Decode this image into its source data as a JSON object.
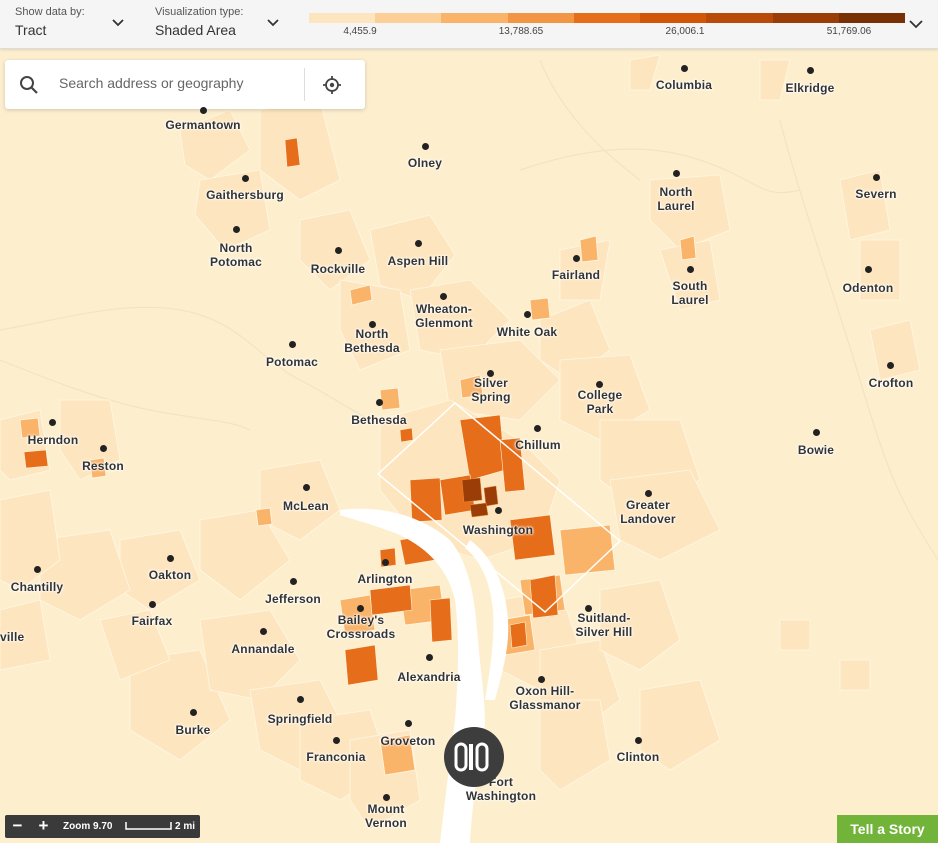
{
  "controls": {
    "show_data": {
      "label": "Show data by:",
      "value": "Tract"
    },
    "viz_type": {
      "label": "Visualization type:",
      "value": "Shaded Area"
    }
  },
  "legend": {
    "colors": [
      "#fde6bf",
      "#fbcf95",
      "#f9b46a",
      "#f29545",
      "#e66e1b",
      "#d25608",
      "#b84b07",
      "#9a3d06",
      "#7a3005"
    ],
    "ticks": [
      "4,455.9",
      "13,788.65",
      "26,006.1",
      "51,769.06"
    ]
  },
  "search": {
    "placeholder": "Search address or geography"
  },
  "map": {
    "water_color": "#ffffff",
    "base_color": "#fdefce",
    "places": [
      {
        "name": "Columbia"
      },
      {
        "name": "Elkridge"
      },
      {
        "name": "Germantown"
      },
      {
        "name": "Olney"
      },
      {
        "name": "Gaithersburg"
      },
      {
        "name": "North\nLaurel"
      },
      {
        "name": "Severn"
      },
      {
        "name": "North\nPotomac"
      },
      {
        "name": "Rockville"
      },
      {
        "name": "Aspen Hill"
      },
      {
        "name": "Fairland"
      },
      {
        "name": "South\nLaurel"
      },
      {
        "name": "Odenton"
      },
      {
        "name": "Wheaton-\nGlenmont"
      },
      {
        "name": "White Oak"
      },
      {
        "name": "North\nBethesda"
      },
      {
        "name": "Potomac"
      },
      {
        "name": "Silver\nSpring"
      },
      {
        "name": "College\nPark"
      },
      {
        "name": "Crofton"
      },
      {
        "name": "Bethesda"
      },
      {
        "name": "Herndon"
      },
      {
        "name": "Chillum"
      },
      {
        "name": "Bowie"
      },
      {
        "name": "Reston"
      },
      {
        "name": "McLean"
      },
      {
        "name": "Washington"
      },
      {
        "name": "Greater\nLandover"
      },
      {
        "name": "Oakton"
      },
      {
        "name": "Arlington"
      },
      {
        "name": "Chantilly"
      },
      {
        "name": "Jefferson"
      },
      {
        "name": "Fairfax"
      },
      {
        "name": "Bailey's\nCrossroads"
      },
      {
        "name": "Suitland-\nSilver Hill"
      },
      {
        "name": "ville"
      },
      {
        "name": "Annandale"
      },
      {
        "name": "Alexandria"
      },
      {
        "name": "Oxon Hill-\nGlassmanor"
      },
      {
        "name": "Springfield"
      },
      {
        "name": "Burke"
      },
      {
        "name": "Groveton"
      },
      {
        "name": "Franconia"
      },
      {
        "name": "Clinton"
      },
      {
        "name": "Fort\nWashington"
      },
      {
        "name": "Mount\nVernon"
      }
    ]
  },
  "zoom": {
    "minus": "−",
    "plus": "+",
    "level": "Zoom 9.70",
    "scale": "2 mi"
  },
  "story_button": {
    "label": "Tell a Story"
  }
}
